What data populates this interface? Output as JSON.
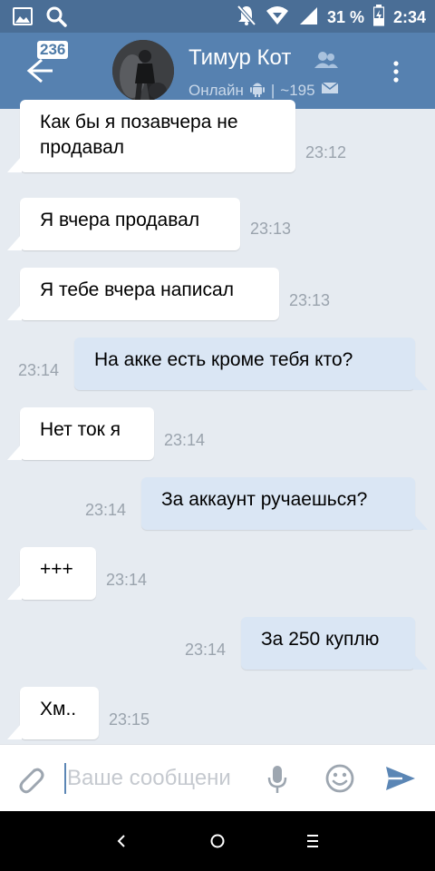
{
  "status_bar": {
    "battery": "31 %",
    "time": "2:34",
    "icons": [
      "image-icon",
      "search-icon",
      "mute-bell-icon",
      "wifi-icon",
      "signal-icon",
      "battery-icon"
    ]
  },
  "header": {
    "back_badge": "236",
    "name": "Тимур Кот",
    "status": "Онлайн",
    "separator": "|",
    "message_count": "~195"
  },
  "messages": [
    {
      "dir": "in",
      "lines": [
        "Как бы я позавчера не",
        "продавал"
      ],
      "time": "23:12"
    },
    {
      "dir": "in",
      "lines": [
        "Я вчера продавал"
      ],
      "time": "23:13"
    },
    {
      "dir": "in",
      "lines": [
        "Я тебе вчера написал"
      ],
      "time": "23:13"
    },
    {
      "dir": "out",
      "lines": [
        "На акке есть кроме тебя кто?"
      ],
      "time": "23:14"
    },
    {
      "dir": "in",
      "lines": [
        "Нет ток я"
      ],
      "time": "23:14"
    },
    {
      "dir": "out",
      "lines": [
        "За аккаунт ручаешься?"
      ],
      "time": "23:14"
    },
    {
      "dir": "in",
      "lines": [
        "+++"
      ],
      "time": "23:14"
    },
    {
      "dir": "out",
      "lines": [
        "За 250 куплю"
      ],
      "time": "23:14"
    },
    {
      "dir": "in",
      "lines": [
        "Хм.."
      ],
      "time": "23:15"
    }
  ],
  "composer": {
    "placeholder": "Ваше сообщени",
    "value": ""
  },
  "colors": {
    "status_bar": "#4a6e96",
    "app_bar": "#5681b0",
    "chat_bg": "#e6ebf1",
    "incoming_bubble": "#ffffff",
    "outgoing_bubble": "#dae6f4",
    "accent": "#5b86b5"
  }
}
